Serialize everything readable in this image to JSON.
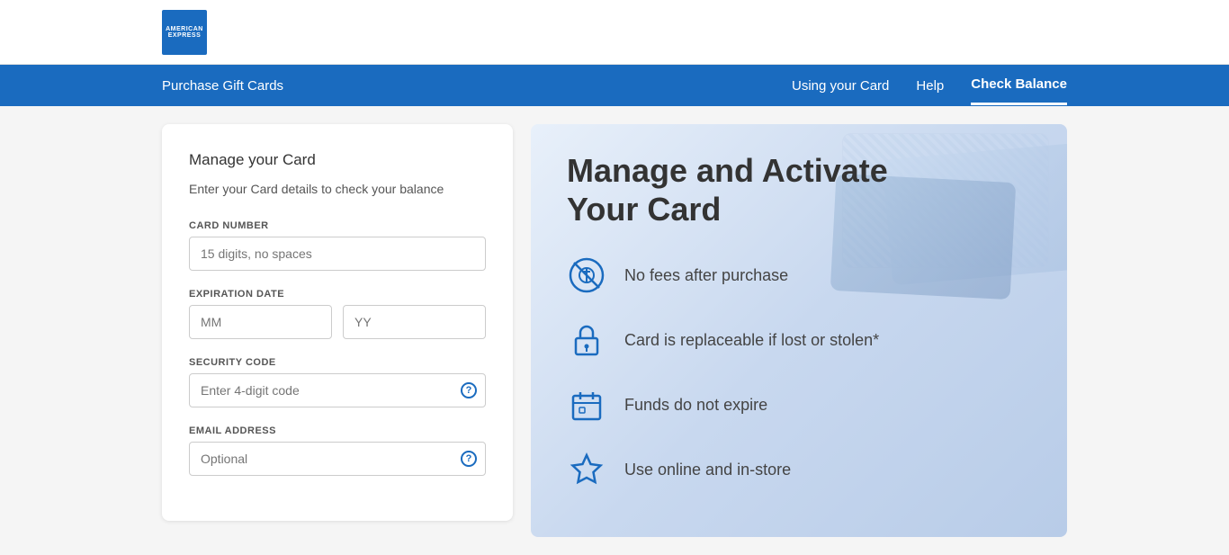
{
  "logo": {
    "line1": "AMERICAN",
    "line2": "EXPRESS"
  },
  "nav": {
    "left_item": "Purchase Gift Cards",
    "right_items": [
      {
        "label": "Using your Card",
        "active": false
      },
      {
        "label": "Help",
        "active": false
      },
      {
        "label": "Check Balance",
        "active": true
      }
    ]
  },
  "form": {
    "title": "Manage your Card",
    "subtitle": "Enter your Card details to check your balance",
    "card_number_label": "CARD NUMBER",
    "card_number_placeholder": "15 digits, no spaces",
    "expiration_label": "EXPIRATION DATE",
    "month_placeholder": "MM",
    "year_placeholder": "YY",
    "security_label": "SECURITY CODE",
    "security_placeholder": "Enter 4-digit code",
    "email_label": "EMAIL ADDRESS",
    "email_placeholder": "Optional"
  },
  "right_panel": {
    "title_line1": "Manage and Activate",
    "title_line2": "Your Card",
    "features": [
      {
        "text": "No fees after purchase",
        "icon": "no-fees-icon"
      },
      {
        "text": "Card is replaceable if lost or stolen*",
        "icon": "lock-icon"
      },
      {
        "text": "Funds do not expire",
        "icon": "calendar-icon"
      },
      {
        "text": "Use online and in-store",
        "icon": "star-icon"
      }
    ]
  },
  "colors": {
    "brand_blue": "#1a6bbf",
    "nav_bg": "#1a6bbf",
    "text_dark": "#333",
    "text_muted": "#555"
  }
}
